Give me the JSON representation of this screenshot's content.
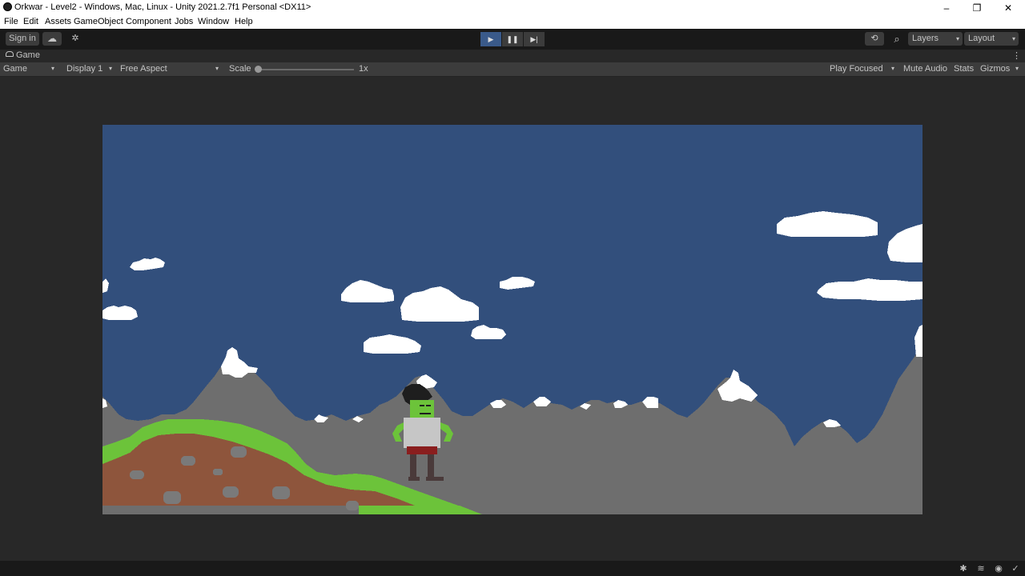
{
  "window": {
    "title": "Orkwar - Level2 - Windows, Mac, Linux - Unity 2021.2.7f1 Personal <DX11>",
    "controls": {
      "minimize": "–",
      "maximize": "❐",
      "close": "✕"
    }
  },
  "menu": [
    "File",
    "Edit",
    "Assets",
    "GameObject",
    "Component",
    "Jobs",
    "Window",
    "Help"
  ],
  "toolbar": {
    "sign_in": "Sign in",
    "layers": "Layers",
    "layout": "Layout",
    "play_glyph": "▶",
    "pause_glyph": "❚❚",
    "step_glyph": "▶|",
    "history_glyph": "⟲",
    "search_glyph": "⌕",
    "cloud_glyph": "☁",
    "collab_glyph": "✲"
  },
  "game_tab": {
    "label": "Game",
    "more_glyph": "⋮"
  },
  "game_bar": {
    "view_mode": "Game",
    "display": "Display 1",
    "aspect": "Free Aspect",
    "scale_label": "Scale",
    "scale_value": "1x",
    "play_mode": "Play Focused",
    "mute": "Mute Audio",
    "stats": "Stats",
    "gizmos": "Gizmos",
    "caret": "▾"
  },
  "colors": {
    "sky": "#324f7c",
    "mountain": "#6e6e6e",
    "snow": "#ffffff",
    "grass": "#6cc33a",
    "dirt": "#8e553c",
    "rock": "#7a7a7a",
    "orc_skin": "#6cc33a",
    "orc_hat": "#1e1e1e",
    "orc_armor": "#c6c6c6",
    "orc_belt": "#8a1e1e",
    "orc_legs": "#4a3a3a"
  },
  "statusbar_icons": [
    "bug-icon",
    "layers-icon",
    "broadcast-icon",
    "check-icon"
  ]
}
